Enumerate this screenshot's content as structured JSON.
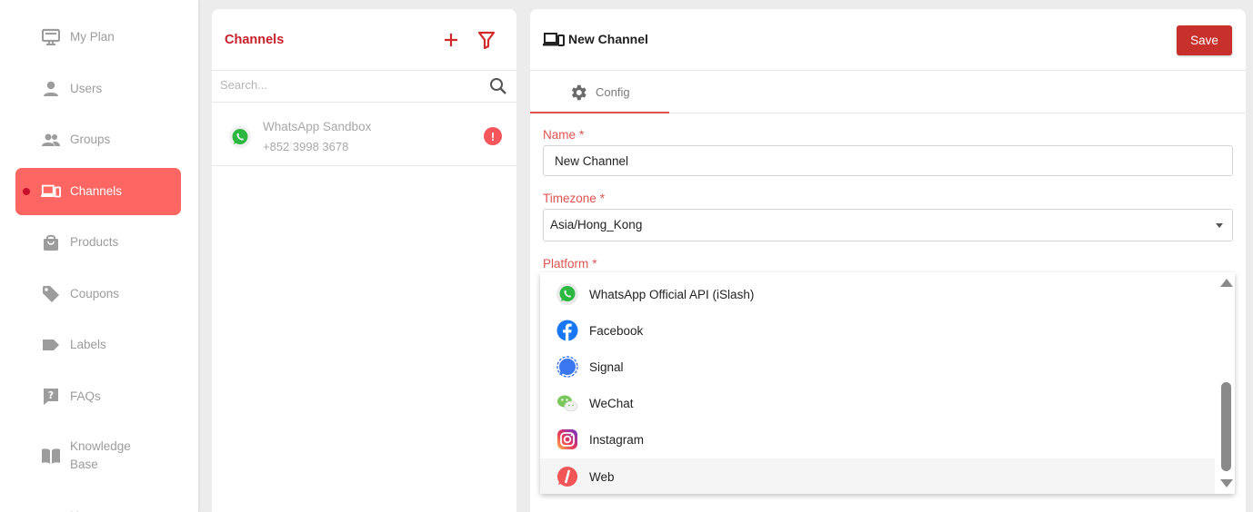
{
  "sidebar": {
    "items": [
      {
        "label": "My Plan",
        "icon": "plan-icon"
      },
      {
        "label": "Users",
        "icon": "user-icon"
      },
      {
        "label": "Groups",
        "icon": "groups-icon"
      },
      {
        "label": "Channels",
        "icon": "devices-icon",
        "active": true
      },
      {
        "label": "Products",
        "icon": "bag-icon"
      },
      {
        "label": "Coupons",
        "icon": "tag-icon"
      },
      {
        "label": "Labels",
        "icon": "label-icon"
      },
      {
        "label": "FAQs",
        "icon": "question-icon"
      },
      {
        "label": "Knowledge Base",
        "label_line1": "Knowledge",
        "label_line2": "Base",
        "icon": "book-icon"
      }
    ]
  },
  "channels": {
    "title": "Channels",
    "search_placeholder": "Search...",
    "list": [
      {
        "name": "WhatsApp Sandbox",
        "phone": "+852 3998 3678",
        "status": "warning"
      }
    ]
  },
  "form": {
    "title": "New Channel",
    "save_label": "Save",
    "tab_config": "Config",
    "name_label": "Name",
    "name_value": "New Channel",
    "timezone_label": "Timezone",
    "timezone_value": "Asia/Hong_Kong",
    "platform_label": "Platform",
    "required_mark": "*"
  },
  "platform_options": [
    {
      "label": "WhatsApp Official API (iSlash)",
      "icon": "whatsapp-icon"
    },
    {
      "label": "Facebook",
      "icon": "facebook-icon"
    },
    {
      "label": "Signal",
      "icon": "signal-icon"
    },
    {
      "label": "WeChat",
      "icon": "wechat-icon"
    },
    {
      "label": "Instagram",
      "icon": "instagram-icon"
    },
    {
      "label": "Web",
      "icon": "web-icon",
      "highlighted": true
    }
  ],
  "colors": {
    "accent": "#fd6662",
    "brand_red": "#c8302b",
    "label_red": "#e05450",
    "whatsapp": "#25d366",
    "facebook": "#1877f2",
    "signal": "#3a76f0"
  }
}
